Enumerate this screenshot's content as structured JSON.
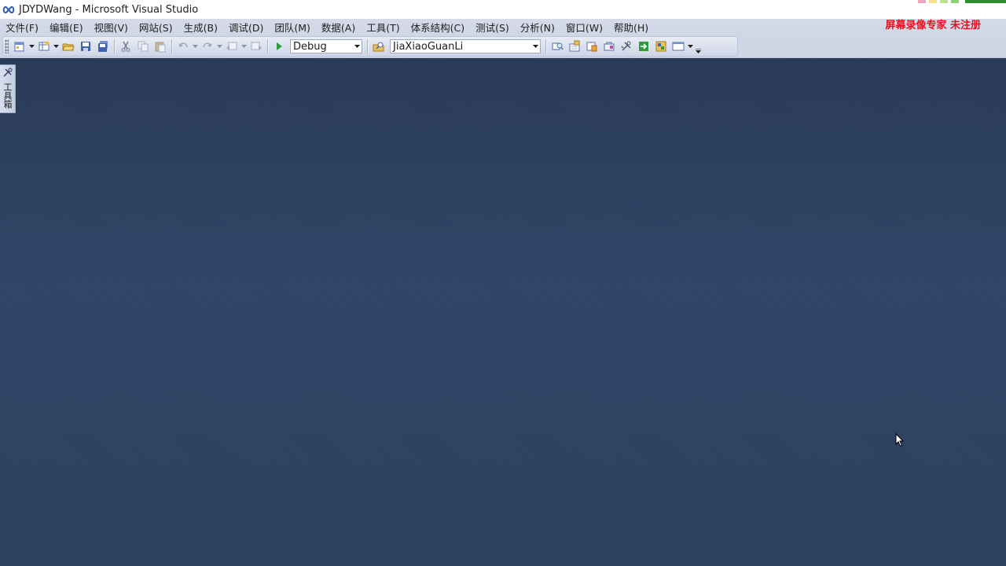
{
  "window": {
    "title": "JDYDWang - Microsoft Visual Studio",
    "icon": "visual-studio-infinity-icon"
  },
  "menu": {
    "items": [
      {
        "label": "文件(F)"
      },
      {
        "label": "编辑(E)"
      },
      {
        "label": "视图(V)"
      },
      {
        "label": "网站(S)"
      },
      {
        "label": "生成(B)"
      },
      {
        "label": "调试(D)"
      },
      {
        "label": "团队(M)"
      },
      {
        "label": "数据(A)"
      },
      {
        "label": "工具(T)"
      },
      {
        "label": "体系结构(C)"
      },
      {
        "label": "测试(S)"
      },
      {
        "label": "分析(N)"
      },
      {
        "label": "窗口(W)"
      },
      {
        "label": "帮助(H)"
      }
    ]
  },
  "watermark": "屏幕录像专家  未注册",
  "toolbar": {
    "configuration": "Debug",
    "startup_project": "JiaXiaoGuanLi"
  },
  "toolbox": {
    "label": "工具箱"
  },
  "colors": {
    "workspace": "#2d4163",
    "menubar": "#d3d9e7",
    "watermark": "#e8101e"
  }
}
